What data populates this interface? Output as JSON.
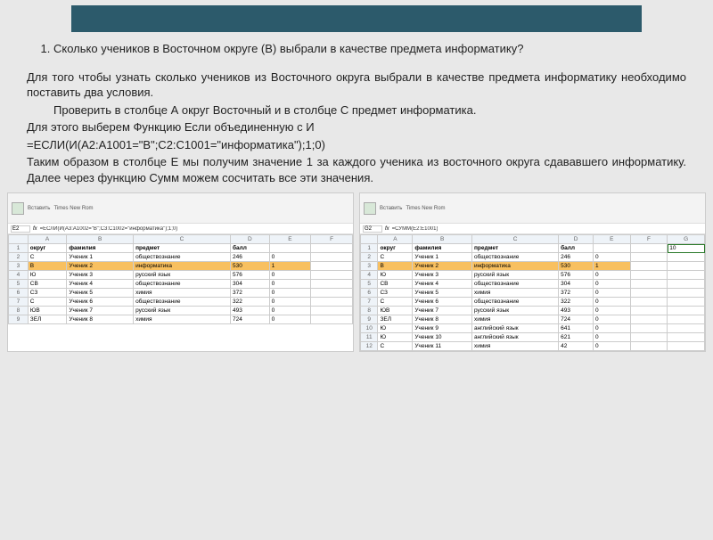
{
  "question": {
    "number": "1.",
    "text": "Сколько учеников в Восточном округе (В) выбрали в качестве предмета информатику?"
  },
  "explanation": {
    "p1": "Для того чтобы узнать сколько учеников из Восточного округа выбрали в качестве предмета информатику необходимо поставить два условия.",
    "p2": "Проверить в столбце А округ Восточный и в столбце С предмет информатика.",
    "p3": "Для этого выберем Функцию Если  объединенную с И",
    "formula": "=ЕСЛИ(И(A2:A1001=\"В\";C2:C1001=\"информатика\");1;0)",
    "p4": "Таким образом в столбце Е мы получим значение 1 за каждого ученика из восточного округа сдававшего информатику. Далее через функцию Сумм можем сосчитать все эти значения."
  },
  "sheet_common": {
    "cols": [
      "A",
      "B",
      "C",
      "D",
      "E",
      "F",
      "G"
    ],
    "headers": {
      "A": "округ",
      "B": "фамилия",
      "C": "предмет",
      "D": "балл"
    }
  },
  "sheet_left": {
    "cellref": "E2",
    "formula": "=ЕСЛИ(И(A3:A1002=\"В\";C3:C1002=\"информатика\");1;0)",
    "rows": [
      {
        "n": 2,
        "A": "С",
        "B": "Ученик 1",
        "C": "обществознание",
        "D": "246",
        "E": "0"
      },
      {
        "n": 3,
        "A": "В",
        "B": "Ученик 2",
        "C": "информатика",
        "D": "530",
        "E": "1",
        "hl": true
      },
      {
        "n": 4,
        "A": "Ю",
        "B": "Ученик 3",
        "C": "русский язык",
        "D": "576",
        "E": "0"
      },
      {
        "n": 5,
        "A": "СВ",
        "B": "Ученик 4",
        "C": "обществознание",
        "D": "304",
        "E": "0"
      },
      {
        "n": 6,
        "A": "СЗ",
        "B": "Ученик 5",
        "C": "химия",
        "D": "372",
        "E": "0"
      },
      {
        "n": 7,
        "A": "С",
        "B": "Ученик 6",
        "C": "обществознание",
        "D": "322",
        "E": "0"
      },
      {
        "n": 8,
        "A": "ЮВ",
        "B": "Ученик 7",
        "C": "русский язык",
        "D": "493",
        "E": "0"
      },
      {
        "n": 9,
        "A": "ЗЕЛ",
        "B": "Ученик 8",
        "C": "химия",
        "D": "724",
        "E": "0"
      }
    ]
  },
  "sheet_right": {
    "cellref": "G2",
    "formula": "=СУММ(E2:E1001)",
    "result": "10",
    "rows": [
      {
        "n": 2,
        "A": "С",
        "B": "Ученик 1",
        "C": "обществознание",
        "D": "246",
        "E": "0"
      },
      {
        "n": 3,
        "A": "В",
        "B": "Ученик 2",
        "C": "информатика",
        "D": "530",
        "E": "1",
        "hl": true
      },
      {
        "n": 4,
        "A": "Ю",
        "B": "Ученик 3",
        "C": "русский язык",
        "D": "576",
        "E": "0"
      },
      {
        "n": 5,
        "A": "СВ",
        "B": "Ученик 4",
        "C": "обществознание",
        "D": "304",
        "E": "0"
      },
      {
        "n": 6,
        "A": "СЗ",
        "B": "Ученик 5",
        "C": "химия",
        "D": "372",
        "E": "0"
      },
      {
        "n": 7,
        "A": "С",
        "B": "Ученик 6",
        "C": "обществознание",
        "D": "322",
        "E": "0"
      },
      {
        "n": 8,
        "A": "ЮВ",
        "B": "Ученик 7",
        "C": "русский язык",
        "D": "493",
        "E": "0"
      },
      {
        "n": 9,
        "A": "ЗЕЛ",
        "B": "Ученик 8",
        "C": "химия",
        "D": "724",
        "E": "0"
      },
      {
        "n": 10,
        "A": "Ю",
        "B": "Ученик 9",
        "C": "английский язык",
        "D": "641",
        "E": "0"
      },
      {
        "n": 11,
        "A": "Ю",
        "B": "Ученик 10",
        "C": "английский язык",
        "D": "621",
        "E": "0"
      },
      {
        "n": 12,
        "A": "С",
        "B": "Ученик 11",
        "C": "химия",
        "D": "42",
        "E": "0"
      }
    ]
  },
  "ribbon_labels": {
    "paste": "Вставить",
    "font": "Times New Rom"
  },
  "chart_data": null
}
